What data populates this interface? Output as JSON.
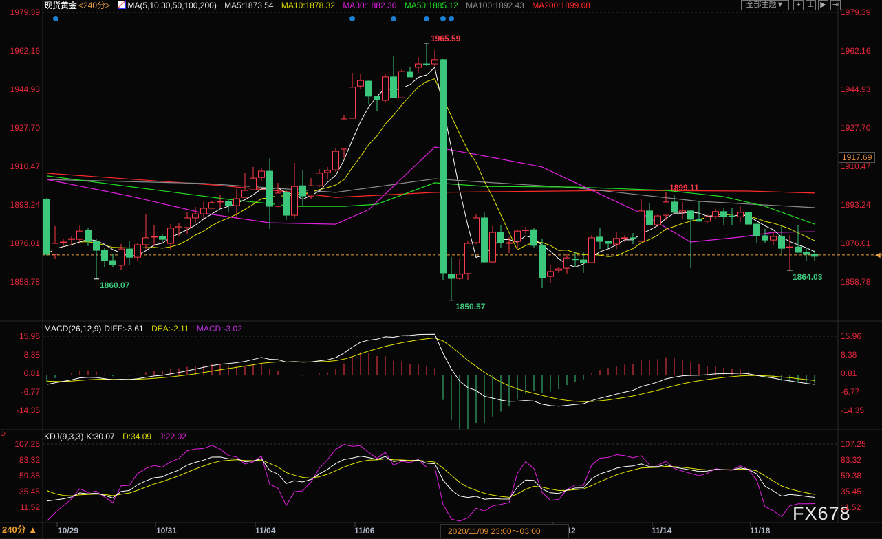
{
  "header": {
    "symbol": "现货黄金",
    "period": "<240分>",
    "ma_params": "MA(5,10,30,50,100,200)",
    "ma5": "MA5:1873.54",
    "ma10": "MA10:1878.32",
    "ma30": "MA30:1882.30",
    "ma50": "MA50:1885.12",
    "ma100": "MA100:1892.43",
    "ma200": "MA200:1899.08",
    "theme_button": "全部主题▼"
  },
  "macd_header": {
    "name": "MACD(26,12,9)",
    "diff": "DIFF:-3.61",
    "dea": "DEA:-2.11",
    "macd": "MACD:-3.02"
  },
  "kdj_header": {
    "name": "KDJ(9,3,3)",
    "k": "K:30.07",
    "d": "D:34.09",
    "j": "J:22.02"
  },
  "price_axis": [
    "1979.39",
    "1962.16",
    "1944.93",
    "1927.70",
    "1910.47",
    "1893.24",
    "1876.01",
    "1858.78"
  ],
  "price_tag": "1917.69",
  "macd_axis": [
    "15.96",
    "8.38",
    "0.81",
    "-6.77",
    "-14.35"
  ],
  "kdj_axis": [
    "107.25",
    "83.32",
    "59.38",
    "35.45",
    "11.52"
  ],
  "x_labels": [
    "10/29",
    "10/31",
    "11/04",
    "11/06",
    "/12",
    "11/14",
    "11/18"
  ],
  "crosshair_time": "2020/11/09 23:00～03:00 一",
  "period_selector": "240分 ▲",
  "watermark": "FX678",
  "annotations": {
    "high": "1965.59",
    "low": "1850.57",
    "left_low": "1860.07",
    "right_high": "1899.11",
    "right_low": "1864.03"
  },
  "colors": {
    "up": "#ff3a4a",
    "down": "#3cc87c",
    "ma5": "#ffffff",
    "ma10": "#e6e600",
    "ma30": "#e020e0",
    "ma50": "#22dd22",
    "ma100": "#8a8a8a",
    "ma200": "#ff2a2a",
    "axis": "#e8283c"
  },
  "chart_data": {
    "type": "candlestick",
    "title": "现货黄金 240分",
    "last_price": 1870.8,
    "ylim": [
      1850,
      1979.39
    ],
    "candles_ohlc": [
      [
        1895.7,
        1896.3,
        1870.2,
        1871.1
      ],
      [
        1871.1,
        1883.7,
        1869.0,
        1876.0
      ],
      [
        1876.3,
        1878.2,
        1874.8,
        1876.6
      ],
      [
        1877.8,
        1879.4,
        1875.1,
        1878.1
      ],
      [
        1877.8,
        1884.3,
        1876.3,
        1881.5
      ],
      [
        1881.8,
        1883.1,
        1874.8,
        1876.9
      ],
      [
        1876.9,
        1878.2,
        1860.07,
        1872.9
      ],
      [
        1872.9,
        1874.1,
        1865.2,
        1868.3
      ],
      [
        1868.3,
        1871.1,
        1865.2,
        1866.5
      ],
      [
        1866.2,
        1875.7,
        1864.0,
        1873.5
      ],
      [
        1873.5,
        1877.2,
        1866.2,
        1869.8
      ],
      [
        1869.8,
        1876.3,
        1868.0,
        1875.4
      ],
      [
        1875.4,
        1889.2,
        1873.5,
        1878.5
      ],
      [
        1878.8,
        1884.3,
        1874.8,
        1879.1
      ],
      [
        1879.1,
        1880.0,
        1876.6,
        1877.8
      ],
      [
        1876.0,
        1884.6,
        1872.9,
        1882.8
      ],
      [
        1883.0,
        1885.2,
        1879.4,
        1883.4
      ],
      [
        1883.1,
        1889.8,
        1880.3,
        1887.4
      ],
      [
        1887.4,
        1892.3,
        1885.2,
        1889.2
      ],
      [
        1889.2,
        1894.5,
        1887.1,
        1891.7
      ],
      [
        1891.7,
        1895.0,
        1892.0,
        1894.2
      ],
      [
        1894.6,
        1897.8,
        1891.7,
        1894.8
      ],
      [
        1894.8,
        1895.4,
        1889.8,
        1892.9
      ],
      [
        1892.9,
        1900.3,
        1886.8,
        1896.0
      ],
      [
        1896.6,
        1907.4,
        1896.6,
        1899.7
      ],
      [
        1900.0,
        1910.2,
        1899.7,
        1905.2
      ],
      [
        1905.5,
        1909.5,
        1904.0,
        1908.3
      ],
      [
        1908.3,
        1914.1,
        1882.5,
        1892.6
      ],
      [
        1892.6,
        1903.1,
        1892.3,
        1898.5
      ],
      [
        1898.8,
        1899.7,
        1886.5,
        1888.6
      ],
      [
        1888.6,
        1912.0,
        1887.4,
        1901.5
      ],
      [
        1901.8,
        1908.9,
        1892.6,
        1897.2
      ],
      [
        1897.2,
        1905.2,
        1895.7,
        1901.8
      ],
      [
        1901.8,
        1909.2,
        1901.2,
        1907.4
      ],
      [
        1907.7,
        1910.2,
        1904.9,
        1908.6
      ],
      [
        1908.9,
        1918.8,
        1908.0,
        1917.2
      ],
      [
        1918.2,
        1933.5,
        1914.2,
        1931.7
      ],
      [
        1932.0,
        1952.3,
        1932.0,
        1945.9
      ],
      [
        1946.4,
        1952.0,
        1945.2,
        1948.9
      ],
      [
        1948.6,
        1949.2,
        1938.2,
        1941.9
      ],
      [
        1941.9,
        1941.9,
        1935.1,
        1940.3
      ],
      [
        1940.0,
        1951.7,
        1938.8,
        1950.5
      ],
      [
        1950.5,
        1960.0,
        1941.2,
        1941.2
      ],
      [
        1941.2,
        1953.9,
        1940.9,
        1952.9
      ],
      [
        1952.9,
        1954.8,
        1950.5,
        1950.5
      ],
      [
        1954.8,
        1959.4,
        1952.3,
        1956.3
      ],
      [
        1956.3,
        1965.59,
        1955.4,
        1956.0
      ],
      [
        1956.3,
        1962.8,
        1955.1,
        1958.2
      ],
      [
        1958.2,
        1958.5,
        1859.7,
        1862.8
      ],
      [
        1862.2,
        1869.8,
        1850.57,
        1860.3
      ],
      [
        1860.3,
        1869.2,
        1859.7,
        1862.2
      ],
      [
        1862.5,
        1877.2,
        1859.7,
        1876.0
      ],
      [
        1876.3,
        1888.9,
        1875.7,
        1887.4
      ],
      [
        1887.4,
        1889.8,
        1867.4,
        1867.7
      ],
      [
        1867.7,
        1883.7,
        1867.1,
        1880.9
      ],
      [
        1880.9,
        1884.3,
        1874.1,
        1876.3
      ],
      [
        1876.0,
        1878.8,
        1871.7,
        1876.3
      ],
      [
        1876.9,
        1882.1,
        1873.5,
        1881.5
      ],
      [
        1881.8,
        1883.4,
        1880.3,
        1882.0
      ],
      [
        1882.1,
        1882.8,
        1874.1,
        1875.1
      ],
      [
        1875.1,
        1878.2,
        1856.0,
        1860.6
      ],
      [
        1861.2,
        1866.2,
        1858.2,
        1863.4
      ],
      [
        1864.0,
        1865.5,
        1862.8,
        1864.6
      ],
      [
        1864.9,
        1871.1,
        1862.5,
        1869.5
      ],
      [
        1869.0,
        1872.0,
        1865.5,
        1868.9
      ],
      [
        1868.6,
        1872.0,
        1862.8,
        1867.4
      ],
      [
        1867.4,
        1879.7,
        1867.1,
        1878.5
      ],
      [
        1878.8,
        1883.1,
        1873.5,
        1876.9
      ],
      [
        1876.9,
        1877.2,
        1874.1,
        1876.0
      ],
      [
        1875.7,
        1881.2,
        1873.5,
        1878.2
      ],
      [
        1878.2,
        1879.7,
        1876.6,
        1878.5
      ],
      [
        1878.5,
        1880.6,
        1875.7,
        1878.2
      ],
      [
        1876.9,
        1896.0,
        1876.9,
        1890.5
      ],
      [
        1890.5,
        1894.2,
        1884.3,
        1884.3
      ],
      [
        1884.3,
        1888.9,
        1883.4,
        1888.3
      ],
      [
        1888.6,
        1899.11,
        1886.5,
        1894.5
      ],
      [
        1894.5,
        1897.5,
        1889.9,
        1889.9
      ],
      [
        1889.9,
        1894.5,
        1887.1,
        1890.5
      ],
      [
        1890.5,
        1891.1,
        1864.9,
        1886.8
      ],
      [
        1886.8,
        1895.1,
        1885.9,
        1885.9
      ],
      [
        1885.9,
        1888.9,
        1884.9,
        1888.0
      ],
      [
        1888.0,
        1891.4,
        1886.8,
        1890.2
      ],
      [
        1890.2,
        1891.7,
        1884.0,
        1888.0
      ],
      [
        1888.3,
        1892.0,
        1884.0,
        1888.0
      ],
      [
        1887.9,
        1892.9,
        1885.5,
        1889.9
      ],
      [
        1889.9,
        1890.2,
        1884.6,
        1884.6
      ],
      [
        1884.6,
        1884.9,
        1876.3,
        1879.4
      ],
      [
        1879.4,
        1882.5,
        1876.3,
        1877.5
      ],
      [
        1877.5,
        1881.0,
        1875.1,
        1879.1
      ],
      [
        1879.1,
        1884.0,
        1871.1,
        1873.8
      ],
      [
        1874.1,
        1879.7,
        1864.03,
        1874.4
      ],
      [
        1874.4,
        1884.3,
        1872.0,
        1872.0
      ],
      [
        1872.0,
        1874.1,
        1868.3,
        1871.1
      ],
      [
        1871.1,
        1872.9,
        1868.0,
        1870.2
      ]
    ],
    "ma_series": [
      {
        "name": "MA30",
        "knots": [
          [
            0,
            1904.6
          ],
          [
            10,
            1897.2
          ],
          [
            19,
            1889.5
          ],
          [
            27,
            1885.2
          ],
          [
            35,
            1884.6
          ],
          [
            39,
            1891.1
          ],
          [
            47,
            1919.1
          ],
          [
            53,
            1915.1
          ],
          [
            60,
            1910.2
          ],
          [
            63,
            1904.9
          ],
          [
            72,
            1889.5
          ],
          [
            78,
            1876.6
          ],
          [
            84,
            1878.8
          ],
          [
            88,
            1880.9
          ],
          [
            93,
            1881.2
          ]
        ]
      },
      {
        "name": "MA50",
        "knots": [
          [
            0,
            1906.2
          ],
          [
            22,
            1895.7
          ],
          [
            30,
            1892.6
          ],
          [
            36,
            1892.6
          ],
          [
            40,
            1893.5
          ],
          [
            47,
            1903.1
          ],
          [
            53,
            1901.5
          ],
          [
            64,
            1901.2
          ],
          [
            75,
            1899.7
          ],
          [
            82,
            1896.9
          ],
          [
            87,
            1892.6
          ],
          [
            93,
            1884.6
          ]
        ]
      },
      {
        "name": "MA100",
        "knots": [
          [
            0,
            1904.6
          ],
          [
            19,
            1902.8
          ],
          [
            27,
            1900.9
          ],
          [
            35,
            1898.8
          ],
          [
            47,
            1904.9
          ],
          [
            53,
            1903.4
          ],
          [
            64,
            1900.9
          ],
          [
            79,
            1894.8
          ],
          [
            93,
            1892.0
          ]
        ]
      },
      {
        "name": "MA200",
        "knots": [
          [
            0,
            1907.4
          ],
          [
            21,
            1901.9
          ],
          [
            30,
            1898.8
          ],
          [
            35,
            1896.6
          ],
          [
            47,
            1898.8
          ],
          [
            70,
            1899.7
          ],
          [
            85,
            1899.4
          ],
          [
            93,
            1898.5
          ]
        ]
      }
    ],
    "signal_dots": [
      1,
      37,
      42,
      46,
      48,
      49
    ]
  }
}
